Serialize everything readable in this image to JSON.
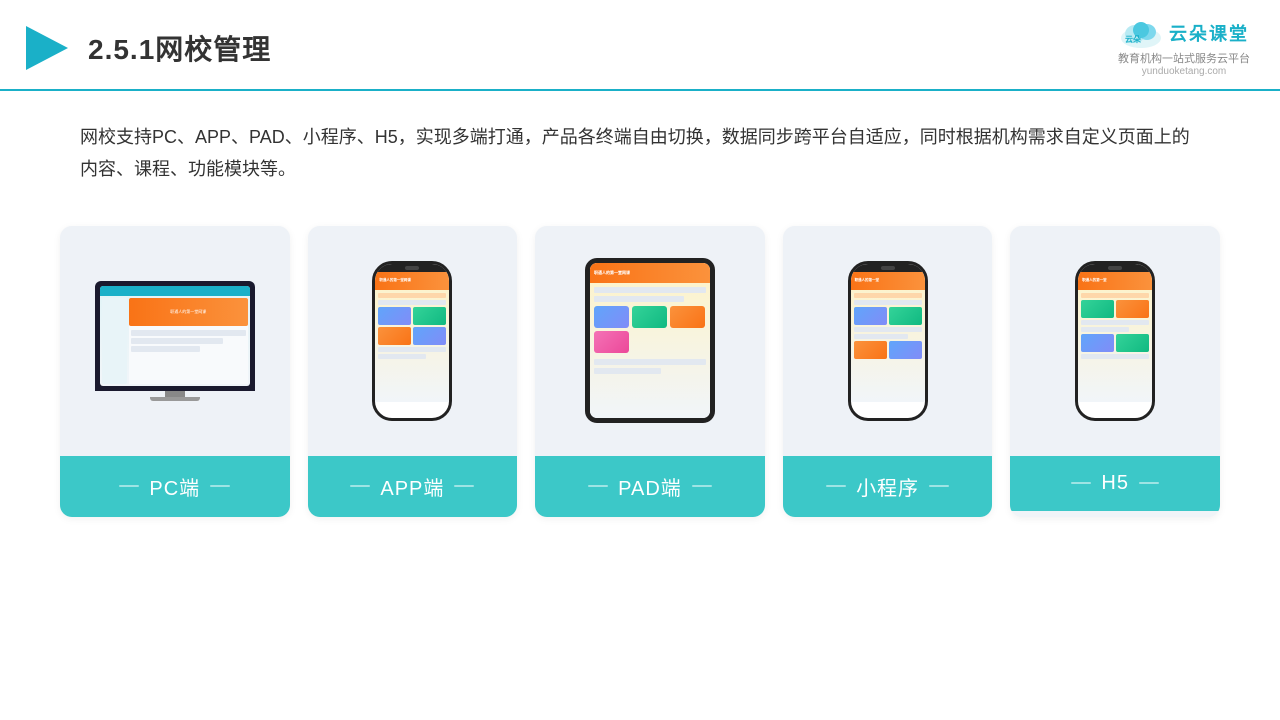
{
  "header": {
    "title_prefix": "2.5.1",
    "title_main": "网校管理",
    "logo_text": "云朵课堂",
    "logo_url": "yunduoketang.com",
    "logo_sub": "教育机构一站\n式服务云平台"
  },
  "description": {
    "text": "网校支持PC、APP、PAD、小程序、H5，实现多端打通，产品各终端自由切换，数据同步跨平台自适应，同时根据机构需求自定义页面上的内容、课程、功能模块等。"
  },
  "cards": [
    {
      "id": "pc",
      "label": "PC端"
    },
    {
      "id": "app",
      "label": "APP端"
    },
    {
      "id": "pad",
      "label": "PAD端"
    },
    {
      "id": "miniapp",
      "label": "小程序"
    },
    {
      "id": "h5",
      "label": "H5"
    }
  ],
  "accent_color": "#3cc8c8"
}
